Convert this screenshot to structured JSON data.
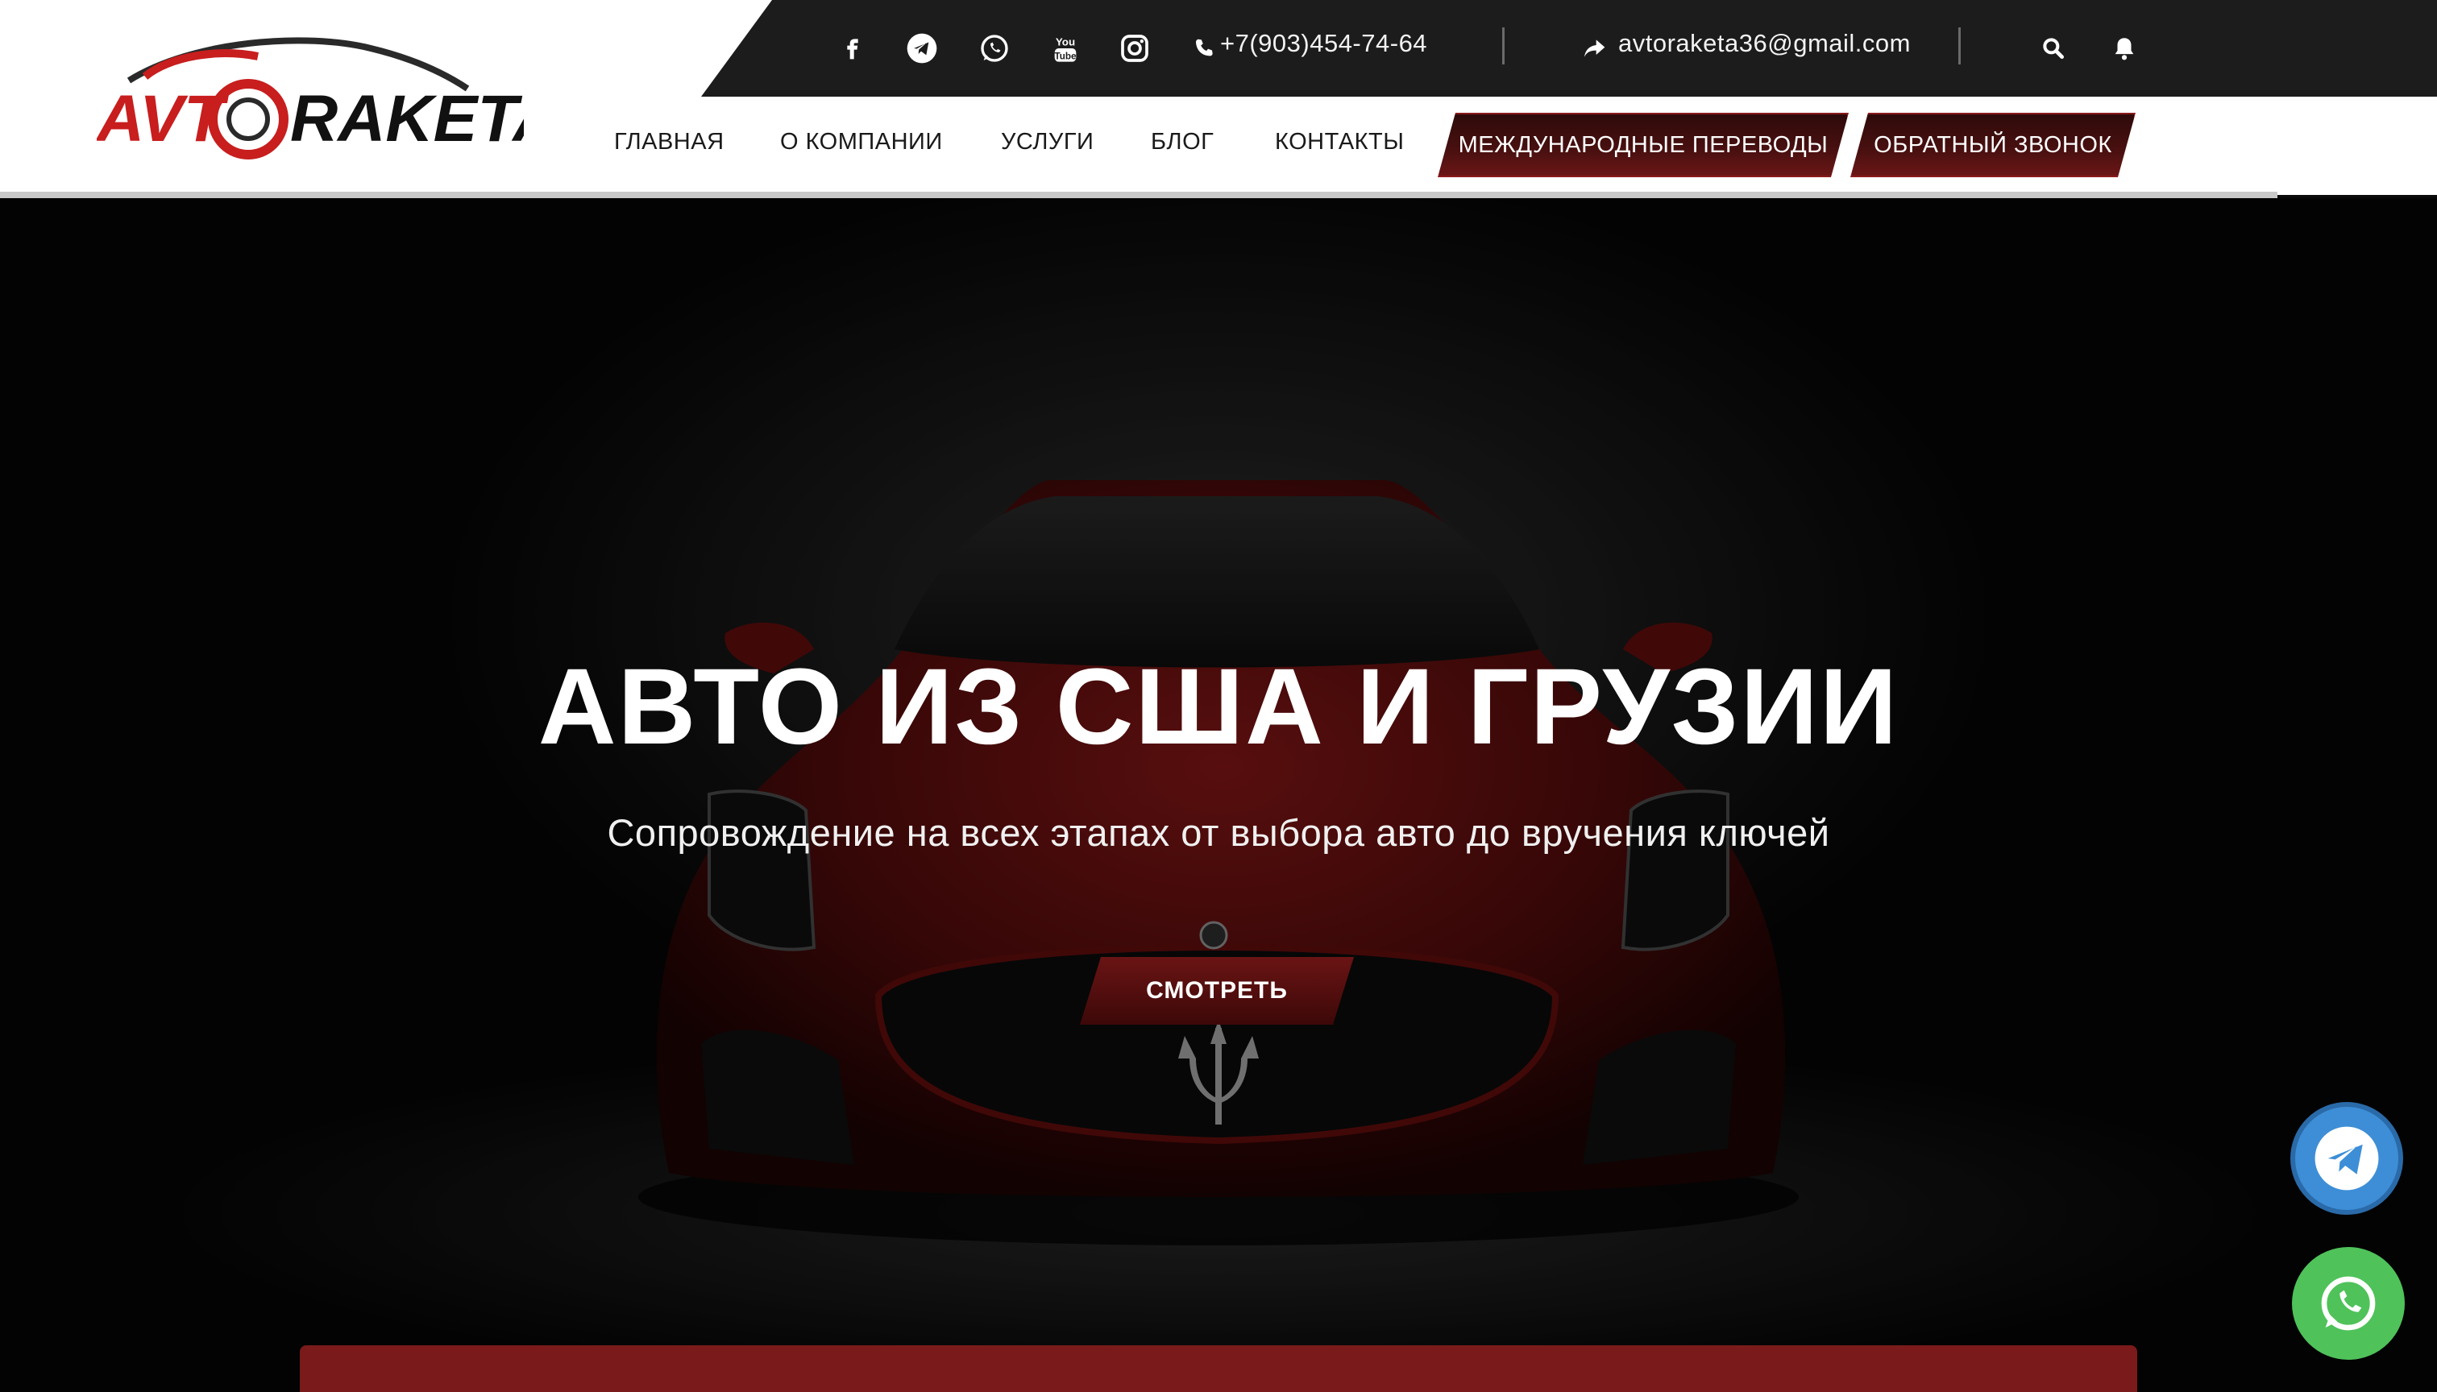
{
  "logo": {
    "text_left": "AVT",
    "text_right": "RAKETA"
  },
  "contacts": {
    "phone": "+7(903)454-74-64",
    "email": "avtoraketa36@gmail.com"
  },
  "social_icons": [
    "facebook-icon",
    "telegram-icon",
    "whatsapp-icon",
    "youtube-icon",
    "instagram-icon"
  ],
  "nav": {
    "items": [
      "ГЛАВНАЯ",
      "О КОМПАНИИ",
      "УСЛУГИ",
      "БЛОГ",
      "КОНТАКТЫ"
    ],
    "btn_transfers": "МЕЖДУНАРОДНЫЕ ПЕРЕВОДЫ",
    "btn_callback": "ОБРАТНЫЙ ЗВОНОК"
  },
  "hero": {
    "title": "АВТО ИЗ США И ГРУЗИИ",
    "subtitle": "Сопровождение на всех этапах от выбора авто до вручения ключей",
    "button": "СМОТРЕТЬ"
  },
  "colors": {
    "accent": "#7a1a1a",
    "topbar": "#1c1c1c",
    "telegram": "#3d8ed6",
    "whatsapp": "#4fc25a"
  }
}
